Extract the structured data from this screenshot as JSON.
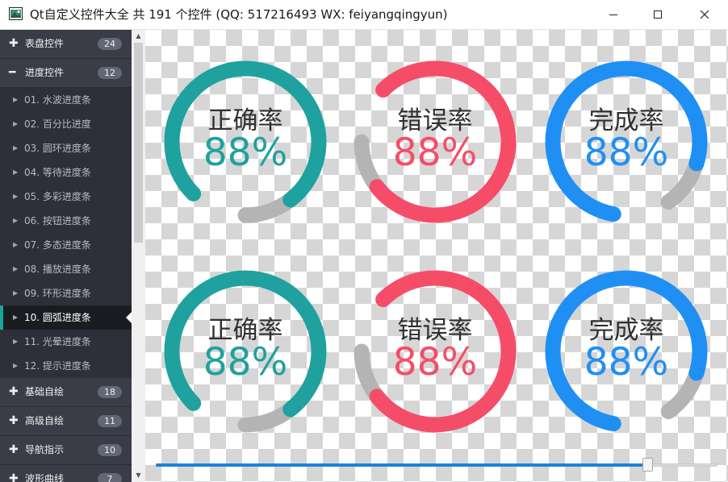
{
  "window": {
    "title": "Qt自定义控件大全 共 191 个控件 (QQ: 517216493 WX: feiyangqingyun)",
    "minimize_glyph": "—",
    "maximize_glyph": "☐",
    "close_glyph": "✕"
  },
  "sidebar": {
    "groups_top": [
      {
        "icon": "plus-icon",
        "sign": "✚",
        "label": "表盘控件",
        "count": "24"
      },
      {
        "icon": "minus-icon",
        "sign": "━",
        "label": "进度控件",
        "count": "12"
      }
    ],
    "items": [
      {
        "label": "01. 水波进度条"
      },
      {
        "label": "02. 百分比进度"
      },
      {
        "label": "03. 圆环进度条"
      },
      {
        "label": "04. 等待进度条"
      },
      {
        "label": "05. 多彩进度条"
      },
      {
        "label": "06. 按钮进度条"
      },
      {
        "label": "07. 多态进度条"
      },
      {
        "label": "08. 播放进度条"
      },
      {
        "label": "09. 环形进度条"
      },
      {
        "label": "10. 圆弧进度条"
      },
      {
        "label": "11. 光晕进度条"
      },
      {
        "label": "12. 提示进度条"
      }
    ],
    "active_index": 9,
    "groups_bottom": [
      {
        "icon": "plus-icon",
        "sign": "✚",
        "label": "基础自绘",
        "count": "18"
      },
      {
        "icon": "plus-icon",
        "sign": "✚",
        "label": "高级自绘",
        "count": "11"
      },
      {
        "icon": "plus-icon",
        "sign": "✚",
        "label": "导航指示",
        "count": "10"
      },
      {
        "icon": "plus-icon",
        "sign": "✚",
        "label": "波形曲线",
        "count": "7"
      }
    ]
  },
  "colors": {
    "teal": "#1fa19f",
    "red": "#f54d68",
    "blue": "#1f8ff4",
    "remain": "#b4b4b4"
  },
  "gauges": [
    {
      "title": "正确率",
      "value": "88%",
      "percent": 88,
      "color_key": "teal",
      "start_deg": 225
    },
    {
      "title": "错误率",
      "value": "88%",
      "percent": 88,
      "color_key": "red",
      "start_deg": 315
    },
    {
      "title": "完成率",
      "value": "88%",
      "percent": 88,
      "color_key": "blue",
      "start_deg": 190
    },
    {
      "title": "正确率",
      "value": "88%",
      "percent": 88,
      "color_key": "teal",
      "start_deg": 225
    },
    {
      "title": "错误率",
      "value": "88%",
      "percent": 88,
      "color_key": "red",
      "start_deg": 315
    },
    {
      "title": "完成率",
      "value": "88%",
      "percent": 88,
      "color_key": "blue",
      "start_deg": 190
    }
  ],
  "slider": {
    "value_fraction": 0.875
  }
}
